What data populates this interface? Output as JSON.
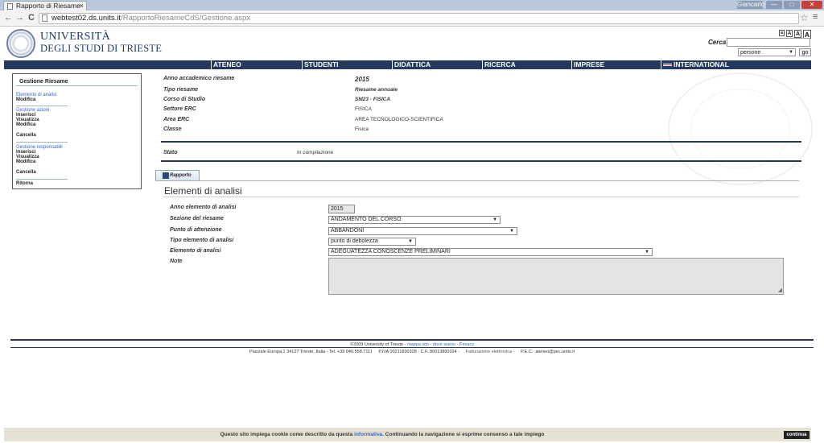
{
  "browser": {
    "tab_title": "Rapporto di Riesame",
    "tab_close": "×",
    "url_host": "webtest02.ds.units.it",
    "url_path": "/RapportoRiesameCdS/Gestione.aspx",
    "back": "←",
    "forward": "→",
    "reload": "C",
    "star": "☆",
    "menu": "≡",
    "user_btn": "Giancarlo",
    "min": "—",
    "max": "□",
    "close": "✕"
  },
  "header": {
    "university_line1": "UNIVERSITÀ",
    "university_line2": "DEGLI STUDI DI TRIESTE",
    "font_sizes": [
      "a",
      "A",
      "A",
      "A"
    ],
    "search_label": "Cerca:",
    "search_value": "",
    "search_scope": "persone",
    "search_go": "go"
  },
  "nav": [
    "ATENEO",
    "STUDENTI",
    "DIDATTICA",
    "RICERCA",
    "IMPRESE",
    "INTERNATIONAL"
  ],
  "sidebar": {
    "title": "Gestione Riesame",
    "section1_link": "Elemento di analisi",
    "section1_actions": [
      "Modifica"
    ],
    "section2_link": "Gestione azioni",
    "section2_actions": [
      "Inserisci",
      "Visualizza",
      "Modifica",
      "Cancella"
    ],
    "section3_link": "Gestione responsabili",
    "section3_actions": [
      "Inserisci",
      "Visualizza",
      "Modifica",
      "Cancella"
    ],
    "back": "Ritorna"
  },
  "info": {
    "labels": [
      "Anno accademico riesame",
      "Tipo riesame",
      "Corso di Studio",
      "Settore ERC",
      "Area ERC",
      "Classe"
    ],
    "values": [
      "2015",
      "Riesame annuale",
      "SM23 - FISICA",
      "FISICA",
      "AREA TECNOLOGICO-SCIENTIFICA",
      "Fisica"
    ],
    "status_label": "Stato",
    "status_value": "In compilazione"
  },
  "tab_label": "Rapporto",
  "section_title": "Elementi di analisi",
  "form": {
    "anno_label": "Anno elemento di analisi",
    "anno_value": "2015",
    "sezione_label": "Sezione del riesame",
    "sezione_value": "ANDAMENTO DEL CORSO",
    "punto_label": "Punto di attenzione",
    "punto_value": "ABBANDONI",
    "tipo_label": "Tipo elemento di analisi",
    "tipo_value": "punto di debolezza",
    "elemento_label": "Elemento di analisi",
    "elemento_value": "ADEGUATEZZA CONOSCENZE PRELIMINARI",
    "note_label": "Note",
    "note_value": ""
  },
  "footer": {
    "copyright": "©2009 University of Trieste",
    "link_map": "mappa sito",
    "link_where": "dove siamo",
    "link_privacy": "Privacy",
    "sep": "-",
    "address": "Piazzale Europa,1 34127 Trieste, Italia - Tel. +39 040.558.7111",
    "piva": "P.IVA 00211830328 - C.F. 80013890324 -",
    "fatturazione": "Fatturazione elettronica -",
    "pec": "P.E.C.: ateneo@pec.units.it"
  },
  "cookie": {
    "text_before": "Questo sito impiega cookie come descritto da questa",
    "link": "informativa",
    "text_after": ". Continuando la navigazione si esprime consenso a tale impiego",
    "button": "continua"
  }
}
